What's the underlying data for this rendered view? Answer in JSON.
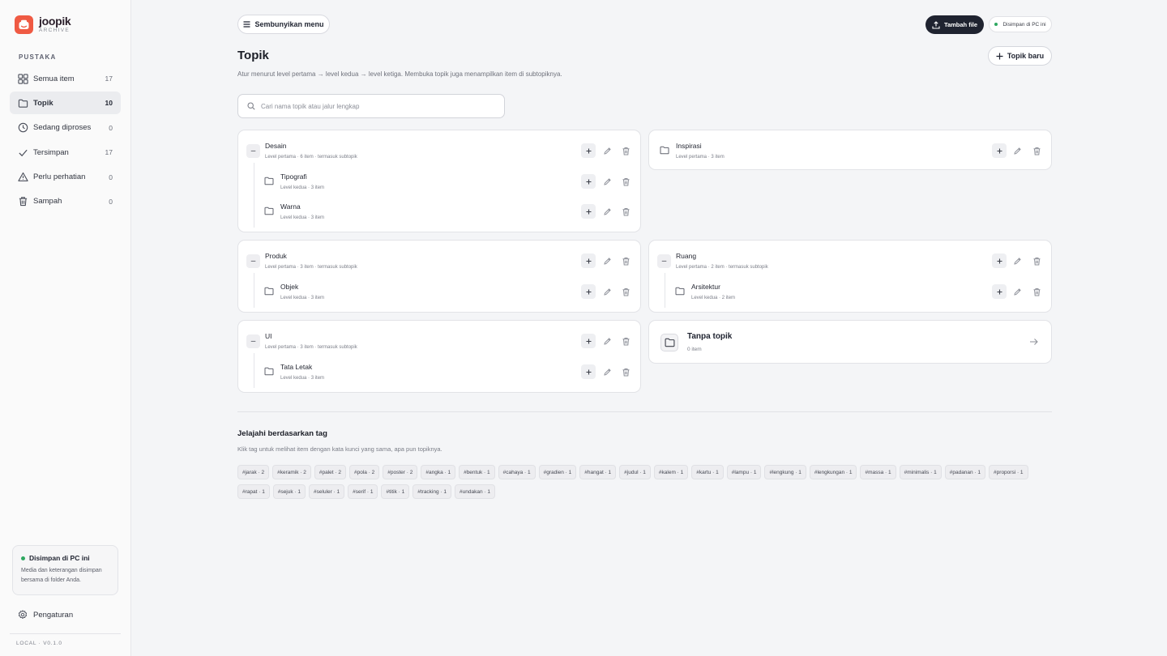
{
  "brand": {
    "name": "joopik",
    "sub": "ARCHIVE",
    "accent": "#ef5a43"
  },
  "sidebar": {
    "section": "PUSTAKA",
    "items": [
      {
        "icon": "grid-icon",
        "label": "Semua item",
        "count": "17"
      },
      {
        "icon": "folder-icon",
        "label": "Topik",
        "count": "10",
        "active": true
      },
      {
        "icon": "clock-icon",
        "label": "Sedang diproses",
        "count": "0"
      },
      {
        "icon": "check-icon",
        "label": "Tersimpan",
        "count": "17"
      },
      {
        "icon": "warning-icon",
        "label": "Perlu perhatian",
        "count": "0"
      },
      {
        "icon": "trash-icon",
        "label": "Sampah",
        "count": "0"
      }
    ],
    "local_card": {
      "title": "Disimpan di PC ini",
      "desc": "Media dan keterangan disimpan bersama di folder Anda."
    },
    "settings": "Pengaturan",
    "version": "LOCAL · V0.1.0"
  },
  "header": {
    "hide_menu": "Sembunyikan menu",
    "add_file": "Tambah file",
    "saved_local": "Disimpan di PC ini"
  },
  "page": {
    "title": "Topik",
    "desc": "Atur menurut level pertama → level kedua → level ketiga. Membuka topik juga menampilkan item di subtopiknya.",
    "new_topic": "Topik baru",
    "search_placeholder": "Cari nama topik atau jalur lengkap"
  },
  "topics": {
    "desain": {
      "name": "Desain",
      "meta": "Level pertama · 6 item · termasuk subtopik",
      "children": [
        {
          "name": "Tipografi",
          "meta": "Level kedua · 3 item"
        },
        {
          "name": "Warna",
          "meta": "Level kedua · 3 item"
        }
      ]
    },
    "inspirasi": {
      "name": "Inspirasi",
      "meta": "Level pertama · 3 item"
    },
    "produk": {
      "name": "Produk",
      "meta": "Level pertama · 3 item · termasuk subtopik",
      "children": [
        {
          "name": "Objek",
          "meta": "Level kedua · 3 item"
        }
      ]
    },
    "ruang": {
      "name": "Ruang",
      "meta": "Level pertama · 2 item · termasuk subtopik",
      "children": [
        {
          "name": "Arsitektur",
          "meta": "Level kedua · 2 item"
        }
      ]
    },
    "ui": {
      "name": "UI",
      "meta": "Level pertama · 3 item · termasuk subtopik",
      "children": [
        {
          "name": "Tata Letak",
          "meta": "Level kedua · 3 item"
        }
      ]
    },
    "tanpa": {
      "name": "Tanpa topik",
      "meta": "0 item"
    }
  },
  "tags_section": {
    "title": "Jelajahi berdasarkan tag",
    "desc": "Klik tag untuk melihat item dengan kata kunci yang sama, apa pun topiknya.",
    "tags": [
      "#jarak · 2",
      "#keramik · 2",
      "#palet · 2",
      "#pola · 2",
      "#poster · 2",
      "#angka · 1",
      "#bentuk · 1",
      "#cahaya · 1",
      "#gradien · 1",
      "#hangat · 1",
      "#judul · 1",
      "#kalem · 1",
      "#kartu · 1",
      "#lampu · 1",
      "#lengkung · 1",
      "#lengkungan · 1",
      "#massa · 1",
      "#minimalis · 1",
      "#padanan · 1",
      "#proporsi · 1",
      "#rapat · 1",
      "#sejuk · 1",
      "#seluler · 1",
      "#serif · 1",
      "#titik · 1",
      "#tracking · 1",
      "#undakan · 1"
    ]
  }
}
